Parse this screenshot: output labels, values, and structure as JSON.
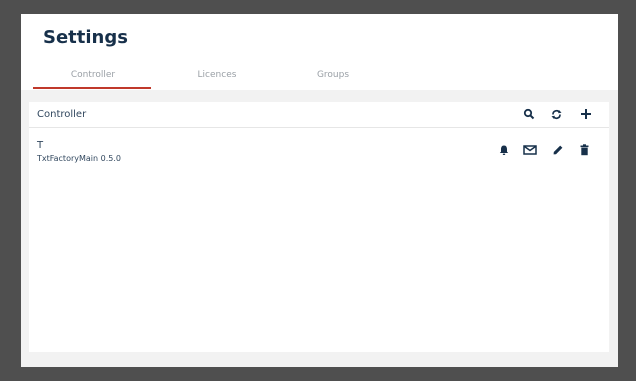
{
  "app": {
    "title": "Settings"
  },
  "tabs": [
    {
      "label": "Controller",
      "active": true
    },
    {
      "label": "Licences",
      "active": false
    },
    {
      "label": "Groups",
      "active": false
    }
  ],
  "panel": {
    "title": "Controller",
    "header_icons": [
      "search-icon",
      "refresh-icon",
      "add-icon"
    ]
  },
  "controllers": [
    {
      "name": "T",
      "version": "TxtFactoryMain 0.5.0",
      "actions": [
        "bell-icon",
        "mail-icon",
        "edit-icon",
        "delete-icon"
      ]
    }
  ],
  "colors": {
    "accent": "#c0392b",
    "title": "#17304a",
    "text": "#31475e",
    "tab_text": "#9aa0a6",
    "backdrop": "#4f4f4f",
    "frame_bg": "#f2f2f2"
  }
}
